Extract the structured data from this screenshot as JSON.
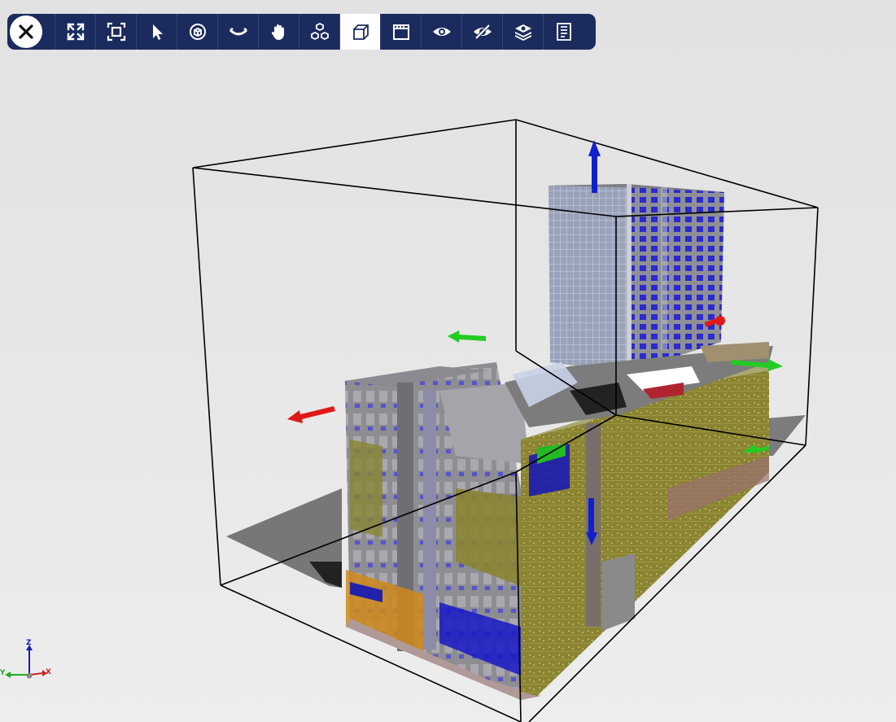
{
  "toolbar": {
    "close_icon": "close-icon",
    "tools": [
      {
        "icon": "fullscreen-icon",
        "active": false
      },
      {
        "icon": "fit-view-icon",
        "active": false
      },
      {
        "icon": "select-pointer-icon",
        "active": false
      },
      {
        "icon": "orbit-icon",
        "active": false
      },
      {
        "icon": "look-around-icon",
        "active": false
      },
      {
        "icon": "pan-hand-icon",
        "active": false
      },
      {
        "icon": "explode-icon",
        "active": false
      },
      {
        "icon": "section-box-icon",
        "active": true
      },
      {
        "icon": "section-plane-icon",
        "active": false
      },
      {
        "icon": "show-icon",
        "active": false
      },
      {
        "icon": "hide-icon",
        "active": false
      },
      {
        "icon": "layers-icon",
        "active": false
      },
      {
        "icon": "properties-icon",
        "active": false
      }
    ]
  },
  "axes": {
    "z": "Z",
    "y": "Y",
    "x": "X"
  },
  "colors": {
    "toolbar_bg": "#1b2b5e",
    "axis_z": "#1a1ab0",
    "axis_y": "#22aa22",
    "axis_x": "#cc2222",
    "gizmo_blue": "#1020d0",
    "gizmo_green": "#22cc22",
    "gizmo_red": "#e01818"
  }
}
